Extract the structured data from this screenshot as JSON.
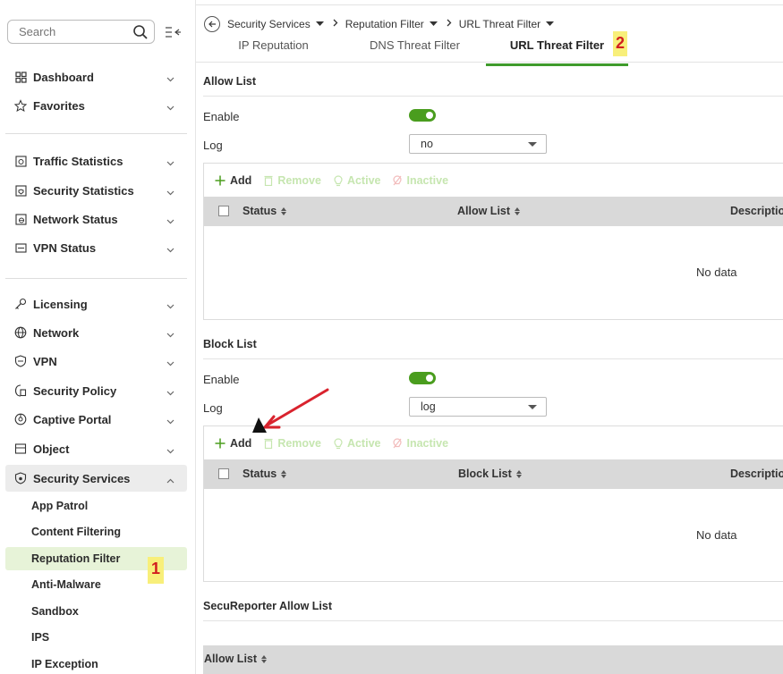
{
  "sidebar": {
    "search_placeholder": "Search",
    "items": [
      {
        "label": "Dashboard"
      },
      {
        "label": "Favorites"
      },
      {
        "label": "Traffic Statistics"
      },
      {
        "label": "Security Statistics"
      },
      {
        "label": "Network Status"
      },
      {
        "label": "VPN Status"
      },
      {
        "label": "Licensing"
      },
      {
        "label": "Network"
      },
      {
        "label": "VPN"
      },
      {
        "label": "Security Policy"
      },
      {
        "label": "Captive Portal"
      },
      {
        "label": "Object"
      },
      {
        "label": "Security Services"
      }
    ],
    "sub_items": [
      {
        "label": "App Patrol"
      },
      {
        "label": "Content Filtering"
      },
      {
        "label": "Reputation Filter"
      },
      {
        "label": "Anti-Malware"
      },
      {
        "label": "Sandbox"
      },
      {
        "label": "IPS"
      },
      {
        "label": "IP Exception"
      }
    ],
    "badge": "1"
  },
  "breadcrumb": {
    "items": [
      "Security Services",
      "Reputation Filter",
      "URL Threat Filter"
    ]
  },
  "tabs": {
    "items": [
      "IP Reputation",
      "DNS Threat Filter",
      "URL Threat Filter"
    ],
    "active": "URL Threat Filter",
    "badge": "2"
  },
  "allow_list": {
    "title": "Allow List",
    "enable_label": "Enable",
    "enable_on": true,
    "log_label": "Log",
    "log_value": "no",
    "toolbar": {
      "add": "Add",
      "remove": "Remove",
      "active": "Active",
      "inactive": "Inactive"
    },
    "columns": [
      "Status",
      "Allow List",
      "Descriptio"
    ],
    "empty_text": "No data"
  },
  "block_list": {
    "title": "Block List",
    "enable_label": "Enable",
    "enable_on": true,
    "log_label": "Log",
    "log_value": "log",
    "toolbar": {
      "add": "Add",
      "remove": "Remove",
      "active": "Active",
      "inactive": "Inactive"
    },
    "columns": [
      "Status",
      "Block List",
      "Descriptio"
    ],
    "empty_text": "No data"
  },
  "secureporter": {
    "title": "SecuReporter Allow List",
    "column": "Allow List"
  },
  "colors": {
    "accent_green": "#4a9d1e",
    "tab_underline": "#3f9b2b",
    "selected_bg": "#e7f3d8",
    "badge_bg": "#f8ef7a",
    "badge_text": "#d21e1e",
    "annotation_arrow": "#d9232e"
  }
}
